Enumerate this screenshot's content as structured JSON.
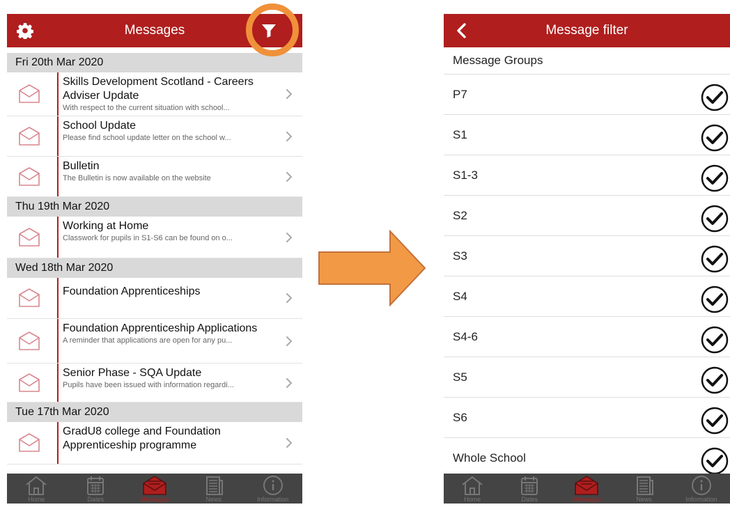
{
  "left": {
    "header_title": "Messages",
    "icons": {
      "settings": "gear-icon",
      "filter": "filter-icon"
    },
    "sections": [
      {
        "date": "Fri 20th Mar 2020",
        "messages": [
          {
            "title": "Skills Development Scotland - Careers Adviser Update",
            "snippet": "With respect to the current situation with school..."
          },
          {
            "title": "School Update",
            "snippet": "Please find school update letter on the school w..."
          },
          {
            "title": "Bulletin",
            "snippet": "The Bulletin is now available on the website"
          }
        ]
      },
      {
        "date": "Thu 19th Mar 2020",
        "messages": [
          {
            "title": "Working at Home",
            "snippet": "Classwork for pupils in S1-S6 can be found on o..."
          }
        ]
      },
      {
        "date": "Wed 18th Mar 2020",
        "messages": [
          {
            "title": "Foundation Apprenticeships",
            "snippet": ""
          },
          {
            "title": "Foundation Apprenticeship Applications",
            "snippet": "A reminder that applications are open for any pu..."
          },
          {
            "title": "Senior Phase - SQA Update",
            "snippet": "Pupils have been issued with information regardi..."
          }
        ]
      },
      {
        "date": "Tue 17th Mar 2020",
        "messages": [
          {
            "title": "GradU8 college and Foundation Apprenticeship programme",
            "snippet": ""
          }
        ]
      }
    ]
  },
  "right": {
    "header_title": "Message filter",
    "section_title": "Message Groups",
    "groups": [
      "P7",
      "S1",
      "S1-3",
      "S2",
      "S3",
      "S4",
      "S4-6",
      "S5",
      "S6",
      "Whole School"
    ]
  },
  "tabbar": {
    "tabs": [
      {
        "label": "Home",
        "icon": "home-icon"
      },
      {
        "label": "Dates",
        "icon": "calendar-icon"
      },
      {
        "label": "Messages",
        "icon": "envelope-icon",
        "active": true
      },
      {
        "label": "News",
        "icon": "newspaper-icon"
      },
      {
        "label": "Information",
        "icon": "info-icon"
      }
    ]
  },
  "colors": {
    "brand_red": "#b01e1e",
    "highlight_orange": "#f0913a",
    "tabbar": "#444444",
    "date_header": "#d9d9d9"
  }
}
